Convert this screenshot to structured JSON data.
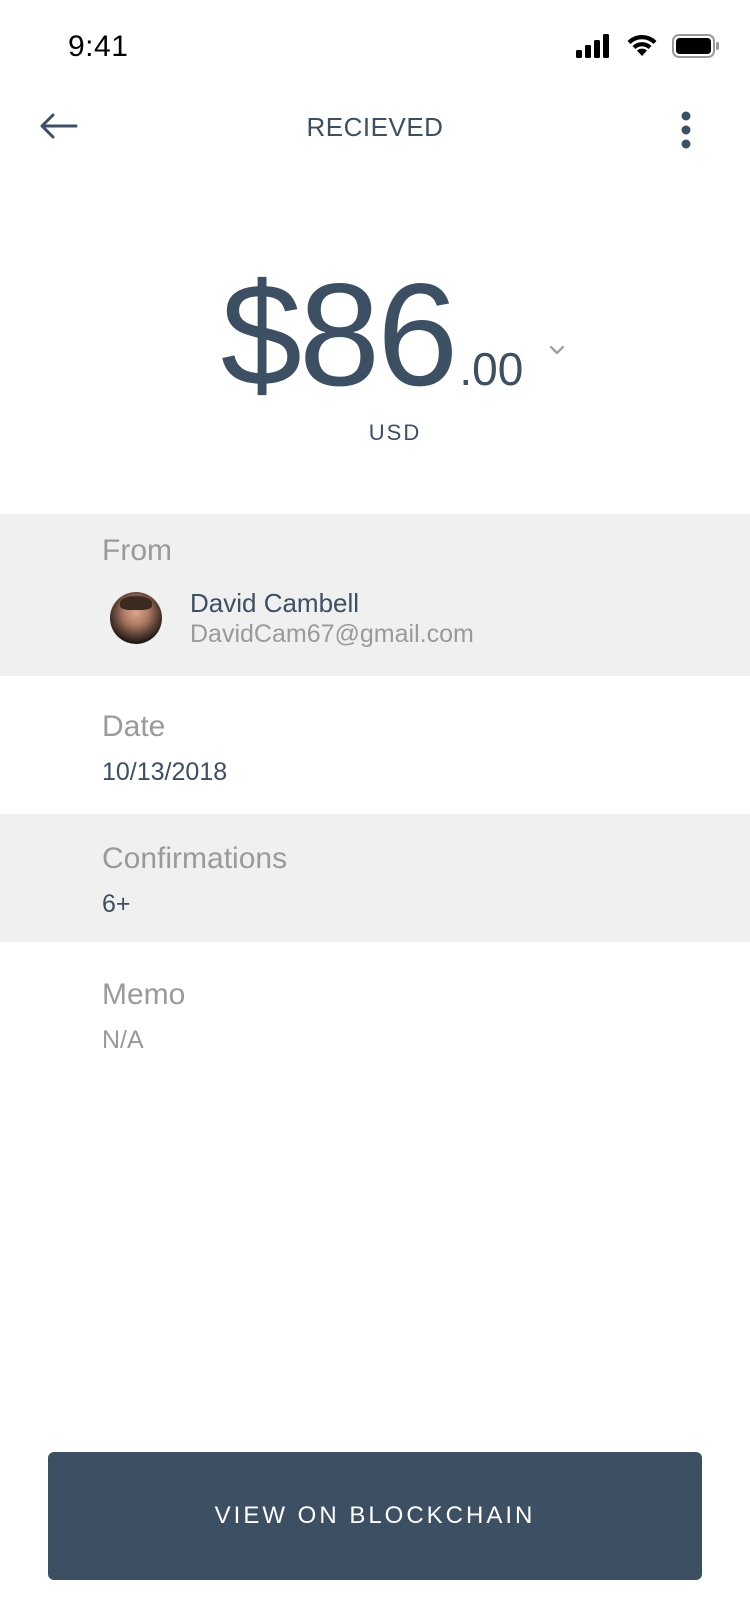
{
  "status_bar": {
    "time": "9:41",
    "icons": [
      "signal-icon",
      "wifi-icon",
      "battery-icon"
    ]
  },
  "nav": {
    "title": "RECIEVED",
    "back_icon": "arrow-left-icon",
    "more_icon": "more-vertical-icon"
  },
  "amount": {
    "main": "$86",
    "cents": ".00",
    "currency": "USD",
    "chevron_icon": "chevron-down-icon"
  },
  "details": {
    "from": {
      "label": "From",
      "name": "David Cambell",
      "email": "DavidCam67@gmail.com"
    },
    "date": {
      "label": "Date",
      "value": "10/13/2018"
    },
    "confirmations": {
      "label": "Confirmations",
      "value": "6+"
    },
    "memo": {
      "label": "Memo",
      "value": "N/A"
    }
  },
  "action": {
    "label": "VIEW ON BLOCKCHAIN"
  },
  "colors": {
    "primary": "#3c4f63",
    "muted": "#9a9a9a",
    "row_shade": "#f0f0f0",
    "background": "#ffffff"
  }
}
